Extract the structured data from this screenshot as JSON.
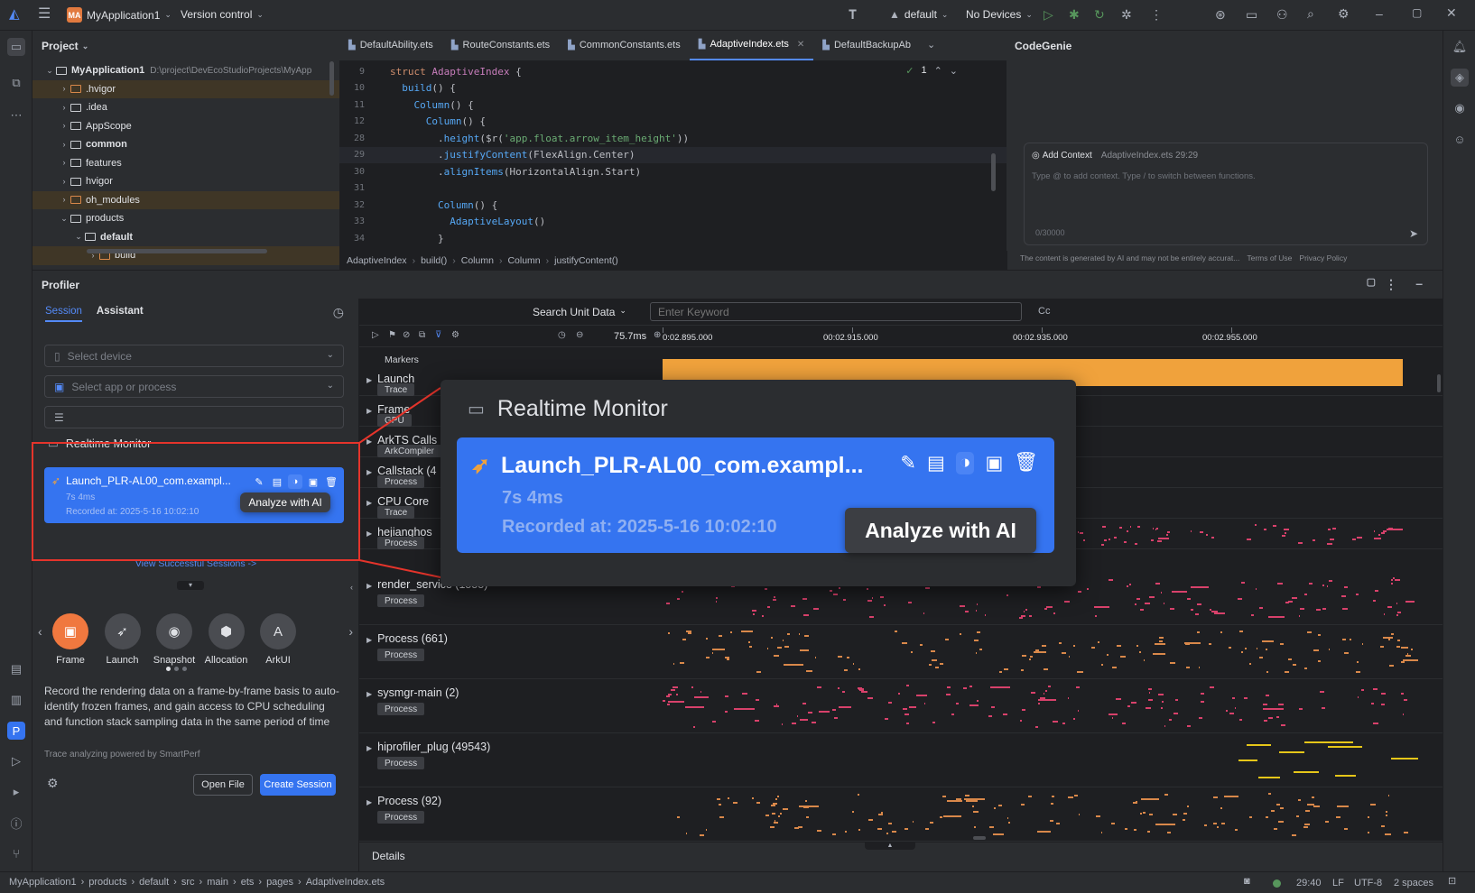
{
  "titlebar": {
    "app_badge": "MA",
    "project_name": "MyApplication1",
    "version_control": "Version control",
    "run_config": "default",
    "devices": "No Devices"
  },
  "project_panel": {
    "title": "Project",
    "root_name": "MyApplication1",
    "root_path": "D:\\project\\DevEcoStudioProjects\\MyApp",
    "items": [
      {
        "label": ".hvigor",
        "indent": 2,
        "expanded": false,
        "highlight": true,
        "orange": true
      },
      {
        "label": ".idea",
        "indent": 2,
        "expanded": false,
        "highlight": false,
        "orange": false
      },
      {
        "label": "AppScope",
        "indent": 2,
        "expanded": false,
        "highlight": false,
        "orange": false
      },
      {
        "label": "common",
        "indent": 2,
        "expanded": false,
        "highlight": false,
        "orange": false,
        "bold": true
      },
      {
        "label": "features",
        "indent": 2,
        "expanded": false,
        "highlight": false,
        "orange": false
      },
      {
        "label": "hvigor",
        "indent": 2,
        "expanded": false,
        "highlight": false,
        "orange": false
      },
      {
        "label": "oh_modules",
        "indent": 2,
        "expanded": false,
        "highlight": true,
        "orange": true
      },
      {
        "label": "products",
        "indent": 2,
        "expanded": true,
        "highlight": false,
        "orange": false
      },
      {
        "label": "default",
        "indent": 3,
        "expanded": true,
        "highlight": false,
        "orange": false,
        "bold": true
      },
      {
        "label": "build",
        "indent": 4,
        "expanded": false,
        "highlight": true,
        "orange": true
      }
    ]
  },
  "editor": {
    "tabs": [
      {
        "label": "DefaultAbility.ets",
        "active": false
      },
      {
        "label": "RouteConstants.ets",
        "active": false
      },
      {
        "label": "CommonConstants.ets",
        "active": false
      },
      {
        "label": "AdaptiveIndex.ets",
        "active": true
      },
      {
        "label": "DefaultBackupAb",
        "active": false
      }
    ],
    "inspection": "1",
    "lines": [
      {
        "num": "9",
        "code": [
          [
            "kw",
            "struct "
          ],
          [
            "ty",
            "AdaptiveIndex"
          ],
          [
            "pl",
            " {"
          ]
        ]
      },
      {
        "num": "10",
        "code": [
          [
            "pl",
            "  "
          ],
          [
            "fn",
            "build"
          ],
          [
            "pl",
            "() {"
          ]
        ]
      },
      {
        "num": "11",
        "code": [
          [
            "pl",
            "    "
          ],
          [
            "fn",
            "Column"
          ],
          [
            "pl",
            "() {"
          ]
        ]
      },
      {
        "num": "12",
        "code": [
          [
            "pl",
            "      "
          ],
          [
            "fn",
            "Column"
          ],
          [
            "pl",
            "() {"
          ]
        ]
      },
      {
        "num": "28",
        "code": [
          [
            "pl",
            "        ."
          ],
          [
            "fn",
            "height"
          ],
          [
            "pl",
            "($r("
          ],
          [
            "st",
            "'app.float.arrow_item_height'"
          ],
          [
            "pl",
            "))"
          ]
        ]
      },
      {
        "num": "29",
        "code": [
          [
            "pl",
            "        ."
          ],
          [
            "fn",
            "justifyContent"
          ],
          [
            "pl",
            "(FlexAlign.Center)"
          ]
        ]
      },
      {
        "num": "30",
        "code": [
          [
            "pl",
            "        ."
          ],
          [
            "fn",
            "alignItems"
          ],
          [
            "pl",
            "(HorizontalAlign.Start)"
          ]
        ]
      },
      {
        "num": "31",
        "code": [
          [
            "pl",
            ""
          ]
        ]
      },
      {
        "num": "32",
        "code": [
          [
            "pl",
            "        "
          ],
          [
            "fn",
            "Column"
          ],
          [
            "pl",
            "() {"
          ]
        ]
      },
      {
        "num": "33",
        "code": [
          [
            "pl",
            "          "
          ],
          [
            "fn",
            "AdaptiveLayout"
          ],
          [
            "pl",
            "()"
          ]
        ]
      },
      {
        "num": "34",
        "code": [
          [
            "pl",
            "        }"
          ]
        ]
      }
    ],
    "breadcrumbs": [
      "AdaptiveIndex",
      "build()",
      "Column",
      "Column",
      "justifyContent()"
    ]
  },
  "codegenie": {
    "title": "CodeGenie",
    "add_context": "Add Context",
    "context_file": "AdaptiveIndex.ets 29:29",
    "placeholder": "Type @ to add context. Type / to switch between functions.",
    "counter": "0/30000",
    "disclaimer": "The content is generated by AI and may not be entirely accurat...",
    "terms": "Terms of Use",
    "privacy": "Privacy Policy"
  },
  "profiler": {
    "title": "Profiler",
    "tabs": [
      "Session",
      "Assistant"
    ],
    "select_device": "Select device",
    "select_app": "Select app or process",
    "realtime_title": "Realtime Monitor",
    "session_name": "Launch_PLR-AL00_com.exampl...",
    "session_duration": "7s 4ms",
    "session_recorded": "Recorded at: 2025-5-16 10:02:10",
    "tooltip": "Analyze with AI",
    "view_sessions": "View Successful Sessions ->",
    "tools": [
      {
        "label": "Frame",
        "active": true,
        "glyph": "▣"
      },
      {
        "label": "Launch",
        "active": false,
        "glyph": "➶"
      },
      {
        "label": "Snapshot",
        "active": false,
        "glyph": "◉"
      },
      {
        "label": "Allocation",
        "active": false,
        "glyph": "⬢"
      },
      {
        "label": "ArkUI",
        "active": false,
        "glyph": "A"
      }
    ],
    "description": "Record the rendering data on a frame-by-frame basis to auto-identify frozen frames, and gain access to CPU scheduling and function stack sampling data in the same period of time",
    "powered_by": "Trace analyzing powered by SmartPerf",
    "open_file": "Open File",
    "create_session": "Create Session"
  },
  "timeline": {
    "search_unit": "Search Unit Data",
    "keyword_placeholder": "Enter Keyword",
    "case_toggle": "Cc",
    "zoom_value": "75.7ms",
    "ticks": [
      "0:02.895.000",
      "00:02.915.000",
      "00:02.935.000",
      "00:02.955.000"
    ],
    "markers_label": "Markers",
    "tracks": [
      {
        "name": "Launch",
        "badge": "Trace"
      },
      {
        "name": "Frame",
        "badge": "GPU"
      },
      {
        "name": "ArkTS Calls",
        "badge": "ArkCompiler"
      },
      {
        "name": "Callstack (4",
        "badge": "Process"
      },
      {
        "name": "CPU Core",
        "badge": "Trace"
      },
      {
        "name": "hejianghos",
        "badge": "Process"
      },
      {
        "name": "render_service (1555)",
        "badge": "Process"
      },
      {
        "name": "Process (661)",
        "badge": "Process"
      },
      {
        "name": "sysmgr-main (2)",
        "badge": "Process"
      },
      {
        "name": "hiprofiler_plug (49543)",
        "badge": "Process"
      },
      {
        "name": "Process (92)",
        "badge": "Process"
      }
    ],
    "details": "Details"
  },
  "statusbar": {
    "path": [
      "MyApplication1",
      "products",
      "default",
      "src",
      "main",
      "ets",
      "pages",
      "AdaptiveIndex.ets"
    ],
    "position": "29:40",
    "line_sep": "LF",
    "encoding": "UTF-8",
    "indent": "2 spaces"
  },
  "colors": {
    "accent": "#3574f0",
    "highlight_red": "#e5342b",
    "launch_bar": "#f0a23c",
    "frame_tool": "#f0783f"
  }
}
